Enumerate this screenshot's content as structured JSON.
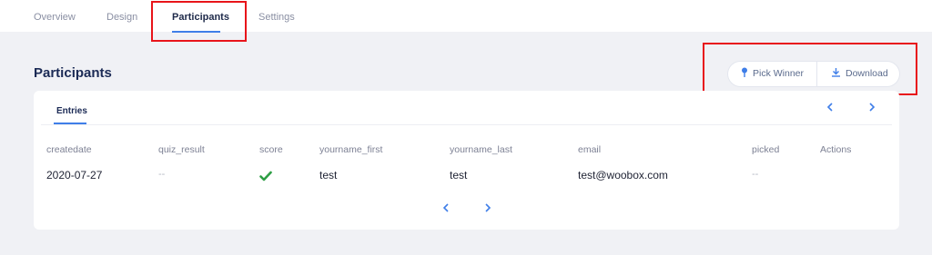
{
  "nav": {
    "tabs": [
      {
        "label": "Overview"
      },
      {
        "label": "Design"
      },
      {
        "label": "Participants"
      },
      {
        "label": "Settings"
      }
    ],
    "active_index": 2
  },
  "section": {
    "title": "Participants"
  },
  "actions": {
    "pick_winner_label": "Pick Winner",
    "download_label": "Download"
  },
  "card": {
    "tab_label": "Entries",
    "columns": [
      "createdate",
      "quiz_result",
      "score",
      "yourname_first",
      "yourname_last",
      "email",
      "picked",
      "Actions"
    ],
    "rows": [
      {
        "createdate": "2020-07-27",
        "quiz_result": "--",
        "score": "check-icon",
        "yourname_first": "test",
        "yourname_last": "test",
        "email": "test@woobox.com",
        "picked": "--",
        "actions": ""
      }
    ]
  },
  "colors": {
    "accent": "#3f7ee8",
    "highlight": "#e8141a",
    "success": "#2e9e45"
  }
}
